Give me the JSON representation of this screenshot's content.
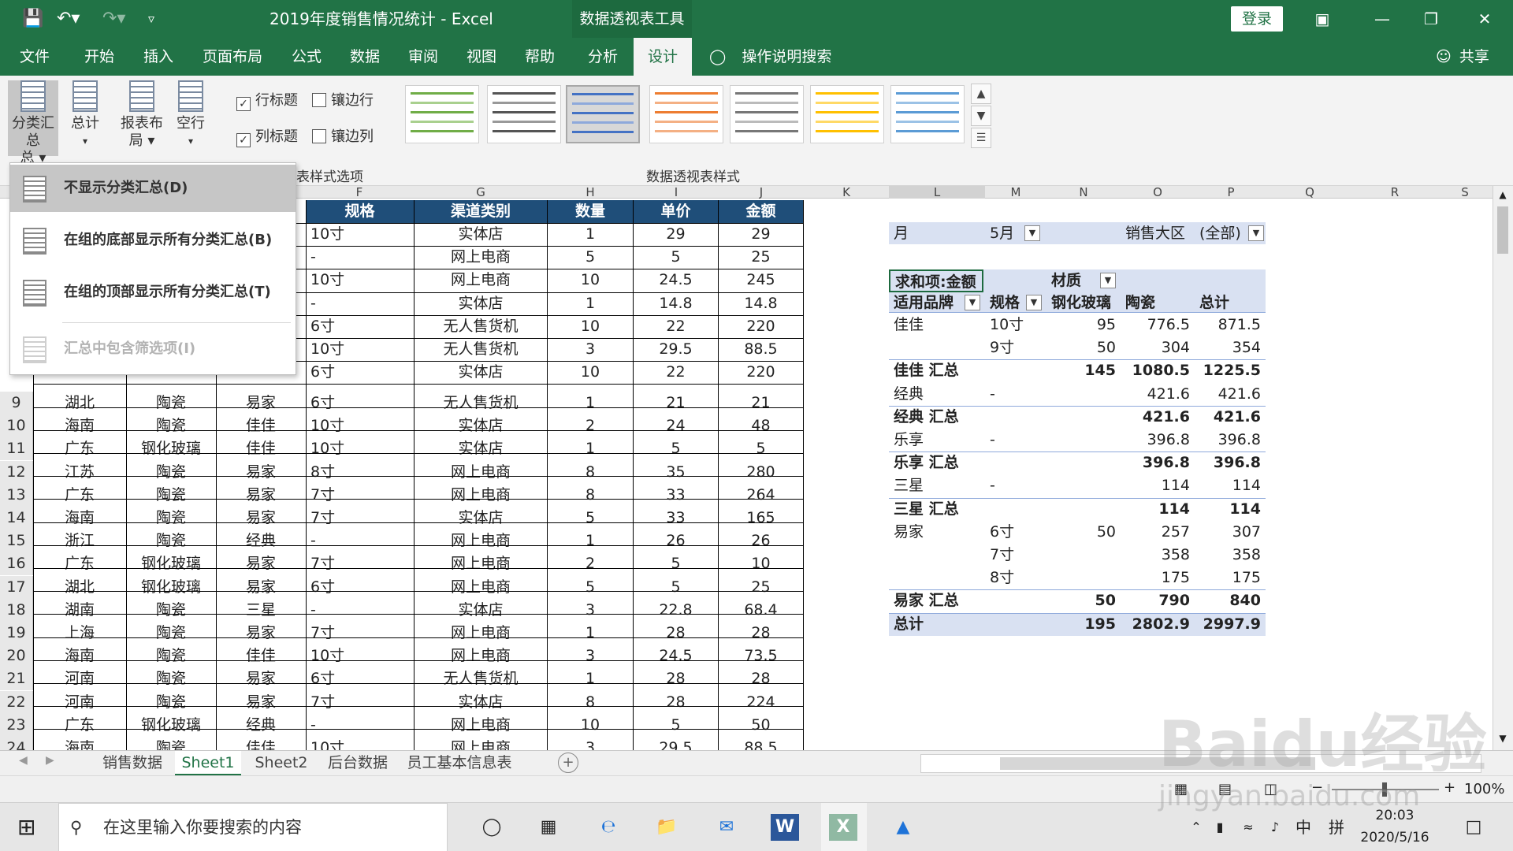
{
  "titlebar": {
    "title": "2019年度销售情况统计 - Excel",
    "context_tools": "数据透视表工具",
    "login": "登录"
  },
  "tabs": [
    "文件",
    "开始",
    "插入",
    "页面布局",
    "公式",
    "数据",
    "审阅",
    "视图",
    "帮助",
    "分析",
    "设计"
  ],
  "active_tab": "设计",
  "tell_me": "操作说明搜索",
  "share": "共享",
  "ribbon": {
    "subtotals": "分类汇总",
    "subtotals_line2": "总",
    "grand_totals": "总计",
    "report_layout": "报表布",
    "report_layout_line2": "局",
    "blank_rows": "空行",
    "row_headers": "行标题",
    "banded_rows": "镶边行",
    "col_headers": "列标题",
    "banded_cols": "镶边列",
    "style_options_group": "表样式选项",
    "styles_group": "数据透视表样式"
  },
  "menu": {
    "items": [
      {
        "label": "不显示分类汇总(D)",
        "state": "highlighted"
      },
      {
        "label": "在组的底部显示所有分类汇总(B)",
        "state": "normal"
      },
      {
        "label": "在组的顶部显示所有分类汇总(T)",
        "state": "normal"
      },
      {
        "label": "汇总中包含筛选项(I)",
        "state": "disabled"
      }
    ]
  },
  "columns": [
    "F",
    "G",
    "H",
    "I",
    "J",
    "K",
    "L",
    "M",
    "N",
    "O",
    "P",
    "Q",
    "R",
    "S"
  ],
  "table_headers": [
    "规格",
    "渠道类别",
    "数量",
    "单价",
    "金额"
  ],
  "upper_rows": [
    [
      "10寸",
      "实体店",
      "1",
      "29",
      "29"
    ],
    [
      "-",
      "网上电商",
      "5",
      "5",
      "25"
    ],
    [
      "10寸",
      "网上电商",
      "10",
      "24.5",
      "245"
    ],
    [
      "-",
      "实体店",
      "1",
      "14.8",
      "14.8"
    ],
    [
      "6寸",
      "无人售货机",
      "10",
      "22",
      "220"
    ],
    [
      "10寸",
      "无人售货机",
      "3",
      "29.5",
      "88.5"
    ],
    [
      "6寸",
      "实体店",
      "10",
      "22",
      "220"
    ]
  ],
  "rows": [
    {
      "n": "9",
      "region": "湖北",
      "material": "陶瓷",
      "brand": "易家",
      "spec": "6寸",
      "channel": "无人售货机",
      "qty": "1",
      "price": "21",
      "amount": "21"
    },
    {
      "n": "10",
      "region": "海南",
      "material": "陶瓷",
      "brand": "佳佳",
      "spec": "10寸",
      "channel": "实体店",
      "qty": "2",
      "price": "24",
      "amount": "48"
    },
    {
      "n": "11",
      "region": "广东",
      "material": "钢化玻璃",
      "brand": "佳佳",
      "spec": "10寸",
      "channel": "实体店",
      "qty": "1",
      "price": "5",
      "amount": "5"
    },
    {
      "n": "12",
      "region": "江苏",
      "material": "陶瓷",
      "brand": "易家",
      "spec": "8寸",
      "channel": "网上电商",
      "qty": "8",
      "price": "35",
      "amount": "280"
    },
    {
      "n": "13",
      "region": "广东",
      "material": "陶瓷",
      "brand": "易家",
      "spec": "7寸",
      "channel": "网上电商",
      "qty": "8",
      "price": "33",
      "amount": "264"
    },
    {
      "n": "14",
      "region": "海南",
      "material": "陶瓷",
      "brand": "易家",
      "spec": "7寸",
      "channel": "实体店",
      "qty": "5",
      "price": "33",
      "amount": "165"
    },
    {
      "n": "15",
      "region": "浙江",
      "material": "陶瓷",
      "brand": "经典",
      "spec": "-",
      "channel": "网上电商",
      "qty": "1",
      "price": "26",
      "amount": "26"
    },
    {
      "n": "16",
      "region": "广东",
      "material": "钢化玻璃",
      "brand": "易家",
      "spec": "7寸",
      "channel": "网上电商",
      "qty": "2",
      "price": "5",
      "amount": "10"
    },
    {
      "n": "17",
      "region": "湖北",
      "material": "钢化玻璃",
      "brand": "易家",
      "spec": "6寸",
      "channel": "网上电商",
      "qty": "5",
      "price": "5",
      "amount": "25"
    },
    {
      "n": "18",
      "region": "湖南",
      "material": "陶瓷",
      "brand": "三星",
      "spec": "-",
      "channel": "实体店",
      "qty": "3",
      "price": "22.8",
      "amount": "68.4"
    },
    {
      "n": "19",
      "region": "上海",
      "material": "陶瓷",
      "brand": "易家",
      "spec": "7寸",
      "channel": "网上电商",
      "qty": "1",
      "price": "28",
      "amount": "28"
    },
    {
      "n": "20",
      "region": "海南",
      "material": "陶瓷",
      "brand": "佳佳",
      "spec": "10寸",
      "channel": "网上电商",
      "qty": "3",
      "price": "24.5",
      "amount": "73.5"
    },
    {
      "n": "21",
      "region": "河南",
      "material": "陶瓷",
      "brand": "易家",
      "spec": "6寸",
      "channel": "无人售货机",
      "qty": "1",
      "price": "28",
      "amount": "28"
    },
    {
      "n": "22",
      "region": "河南",
      "material": "陶瓷",
      "brand": "易家",
      "spec": "7寸",
      "channel": "实体店",
      "qty": "8",
      "price": "28",
      "amount": "224"
    },
    {
      "n": "23",
      "region": "广东",
      "material": "钢化玻璃",
      "brand": "经典",
      "spec": "-",
      "channel": "网上电商",
      "qty": "10",
      "price": "5",
      "amount": "50"
    },
    {
      "n": "24",
      "region": "海南",
      "material": "陶瓷",
      "brand": "佳佳",
      "spec": "10寸",
      "channel": "网上电商",
      "qty": "3",
      "price": "29.5",
      "amount": "88.5"
    }
  ],
  "pivot": {
    "filter1_label": "月",
    "filter1_value": "5月",
    "filter2_label": "销售大区",
    "filter2_value": "(全部)",
    "value_label": "求和项:金额",
    "col_field": "材质",
    "row_field1": "适用品牌",
    "row_field2": "规格",
    "col_glass": "钢化玻璃",
    "col_ceramic": "陶瓷",
    "col_total": "总计",
    "rows": [
      {
        "brand": "佳佳",
        "spec": "10寸",
        "glass": "95",
        "ceramic": "776.5",
        "total": "871.5",
        "bold": false
      },
      {
        "brand": "",
        "spec": "9寸",
        "glass": "50",
        "ceramic": "304",
        "total": "354",
        "bold": false
      },
      {
        "brand": "佳佳 汇总",
        "spec": "",
        "glass": "145",
        "ceramic": "1080.5",
        "total": "1225.5",
        "bold": true
      },
      {
        "brand": "经典",
        "spec": "-",
        "glass": "",
        "ceramic": "421.6",
        "total": "421.6",
        "bold": false
      },
      {
        "brand": "经典 汇总",
        "spec": "",
        "glass": "",
        "ceramic": "421.6",
        "total": "421.6",
        "bold": true
      },
      {
        "brand": "乐享",
        "spec": "-",
        "glass": "",
        "ceramic": "396.8",
        "total": "396.8",
        "bold": false
      },
      {
        "brand": "乐享 汇总",
        "spec": "",
        "glass": "",
        "ceramic": "396.8",
        "total": "396.8",
        "bold": true
      },
      {
        "brand": "三星",
        "spec": "-",
        "glass": "",
        "ceramic": "114",
        "total": "114",
        "bold": false
      },
      {
        "brand": "三星 汇总",
        "spec": "",
        "glass": "",
        "ceramic": "114",
        "total": "114",
        "bold": true
      },
      {
        "brand": "易家",
        "spec": "6寸",
        "glass": "50",
        "ceramic": "257",
        "total": "307",
        "bold": false
      },
      {
        "brand": "",
        "spec": "7寸",
        "glass": "",
        "ceramic": "358",
        "total": "358",
        "bold": false
      },
      {
        "brand": "",
        "spec": "8寸",
        "glass": "",
        "ceramic": "175",
        "total": "175",
        "bold": false
      },
      {
        "brand": "易家 汇总",
        "spec": "",
        "glass": "50",
        "ceramic": "790",
        "total": "840",
        "bold": true
      },
      {
        "brand": "总计",
        "spec": "",
        "glass": "195",
        "ceramic": "2802.9",
        "total": "2997.9",
        "bold": true
      }
    ]
  },
  "sheets": [
    "销售数据",
    "Sheet1",
    "Sheet2",
    "后台数据",
    "员工基本信息表"
  ],
  "active_sheet": "Sheet1",
  "zoom": "100%",
  "taskbar": {
    "search_placeholder": "在这里输入你要搜索的内容",
    "ime_lang": "中",
    "ime_mode": "拼",
    "time": "20:03",
    "date": "2020/5/16"
  },
  "watermark": "Baidu经验",
  "watermark_url": "jingyan.baidu.com",
  "colors": {
    "excel_green": "#217346",
    "header_blue": "#1f4e79",
    "pivot_band": "#d9e1f2"
  }
}
